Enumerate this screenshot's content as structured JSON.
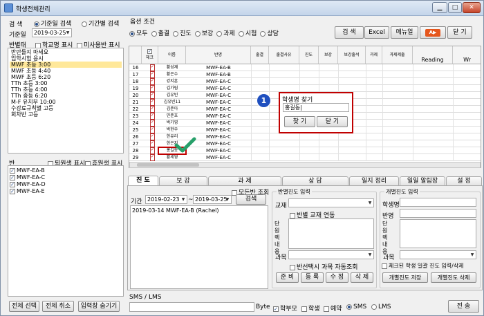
{
  "window": {
    "title": "학생전체관리",
    "min": "▁",
    "max": "□",
    "close": "✕"
  },
  "left": {
    "search_label": "검 색",
    "radio_base": "기준일 검색",
    "radio_period": "기간별 검색",
    "base_date_label": "기준일",
    "base_date": "2019-03-25",
    "class_type_label": "반별태",
    "cb_school": "학교명 표시",
    "cb_unfinished": "미사용반 표시",
    "class_types": [
      "반만들지 마세요",
      "입학시험 응시",
      "MWF 초등 3:00",
      "MWF 초등 4:40",
      "MWF 초등 6:20",
      "TTh 초등 3:00",
      "TTh 초등 4:00",
      "TTh 중등 6:20",
      "M-F 유치부 10:00",
      "수강료규칙별 고등",
      "회차반 고등"
    ],
    "selected_index": 2,
    "ban_label": "반",
    "cb_retired": "퇴원생 표시",
    "cb_leave": "휴원생 표시",
    "bans": [
      "MWF-EA-B",
      "MWF-EA-C",
      "MWF-EA-D",
      "MWF-EA-E"
    ],
    "btn_select_all": "전체 선택",
    "btn_cancel_all": "전체 취소",
    "btn_hide": "입력창 숨기기"
  },
  "options": {
    "title": "옵션 조건",
    "radios": [
      "모두",
      "출결",
      "진도",
      "보강",
      "과제",
      "시험",
      "상담"
    ],
    "selected": 0
  },
  "toolbar": {
    "search": "검 색",
    "excel": "Excel",
    "menu": "메뉴얼",
    "close": "닫 기"
  },
  "grid": {
    "headers": [
      "체크",
      "이름",
      "반명",
      "출결",
      "출결사유",
      "진도",
      "보강",
      "보강출석",
      "과제",
      "과제제출",
      "Reading",
      "Wr"
    ],
    "rows": [
      {
        "no": "16",
        "name": "황성재",
        "ban": "MWF-EA-B"
      },
      {
        "no": "17",
        "name": "황은수",
        "ban": "MWF-EA-B"
      },
      {
        "no": "18",
        "name": "강지훈",
        "ban": "MWF-EA-C"
      },
      {
        "no": "19",
        "name": "김가림",
        "ban": "MWF-EA-C"
      },
      {
        "no": "20",
        "name": "김유빈",
        "ban": "MWF-EA-C"
      },
      {
        "no": "21",
        "name": "김유빈11",
        "ban": "MWF-EA-C"
      },
      {
        "no": "22",
        "name": "김준아",
        "ban": "MWF-EA-C"
      },
      {
        "no": "23",
        "name": "민준호",
        "ban": "MWF-EA-C"
      },
      {
        "no": "24",
        "name": "박가영",
        "ban": "MWF-EA-C"
      },
      {
        "no": "25",
        "name": "박현우",
        "ban": "MWF-EA-C"
      },
      {
        "no": "26",
        "name": "한유리",
        "ban": "MWF-EA-C"
      },
      {
        "no": "27",
        "name": "한은지",
        "ban": "MWF-EA-C"
      },
      {
        "no": "28",
        "name": "홍길동",
        "ban": "MWF-EA-C"
      },
      {
        "no": "29",
        "name": "황세영",
        "ban": "MWF-EA-C"
      }
    ],
    "highlight_index": 12
  },
  "find_dialog": {
    "badge": "1",
    "title": "학생명 찾기",
    "value": "홍길동|",
    "find": "찾 기",
    "close": "닫 기"
  },
  "tabs": [
    "진 도",
    "보 강",
    "과 제",
    "상 담",
    "일지 정리",
    "일일 알림장",
    "설 정"
  ],
  "progress": {
    "period_label": "기간",
    "from": "2019-02-23",
    "to": "2019-03-25",
    "cb_all": "모든반 조회",
    "search": "검색",
    "entry": "2019-03-14   MWF-EA-B   (Rachel)"
  },
  "ban_progress": {
    "title": "반별진도 입력",
    "textbook": "교재",
    "cb_link": "반별 교재 연동",
    "unit": "단원 렉 내용",
    "subject": "과목",
    "cb_auto": "반선택시 과목 자동조회",
    "btns": [
      "준 비",
      "등 록",
      "수 정",
      "삭 제"
    ]
  },
  "indiv_progress": {
    "title": "개별진도 입력",
    "student": "학생명",
    "ban": "반명",
    "unit": "단원 렉 내용",
    "subject": "과목",
    "cb_check": "체크된 학생 일괄 진도 입력/삭제",
    "save": "개별진도 저장",
    "delete": "개별진도 삭제"
  },
  "sms": {
    "title": "SMS / LMS",
    "byte": "Byte",
    "cb_parent": "학부모",
    "cb_student": "학생",
    "cb_reserve": "예약",
    "r_sms": "SMS",
    "r_lms": "LMS",
    "send": "전 송"
  },
  "colors": {
    "accent": "#c00000",
    "highlight": "#ffe89a",
    "badge": "#1f4fbf",
    "check": "#27a06a"
  }
}
